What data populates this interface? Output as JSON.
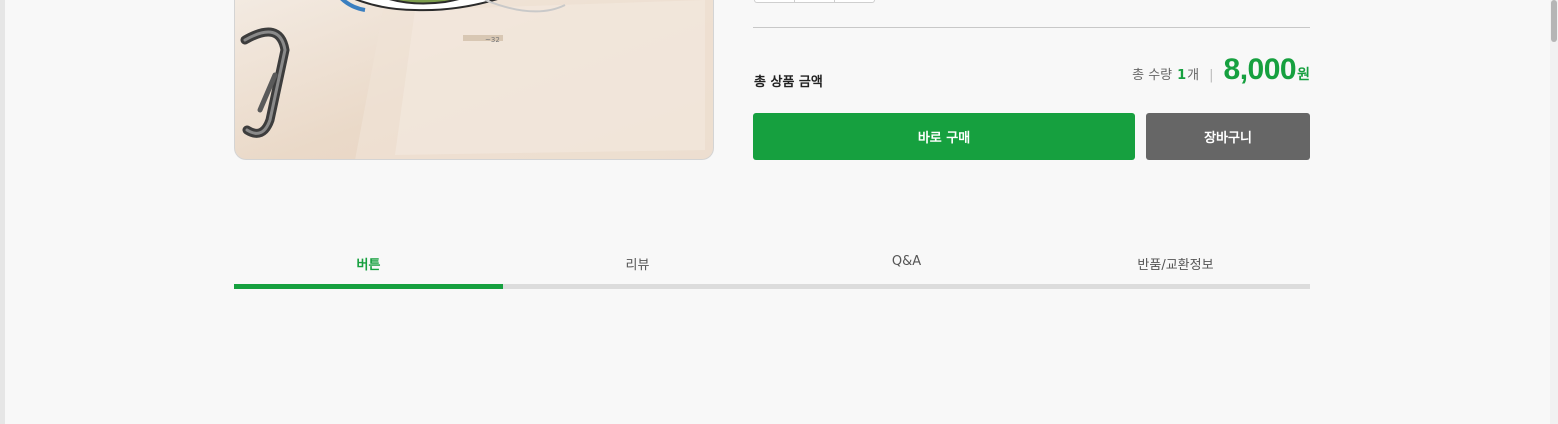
{
  "product": {
    "image_icon": "product-photo"
  },
  "summary": {
    "total_label": "총 상품 금액",
    "qty_prefix": "총 수량",
    "qty_value": "1",
    "qty_suffix": "개",
    "separator": "|",
    "price": "8,000",
    "price_unit": "원"
  },
  "actions": {
    "buy_now_label": "바로 구매",
    "cart_label": "장바구니"
  },
  "tabs": [
    {
      "label": "버튼",
      "active": true
    },
    {
      "label": "리뷰",
      "active": false
    },
    {
      "label": "Q&A",
      "active": false
    },
    {
      "label": "반품/교환정보",
      "active": false
    }
  ],
  "colors": {
    "accent": "#16a03f",
    "cart_button": "#666666",
    "background": "#f8f8f8"
  }
}
